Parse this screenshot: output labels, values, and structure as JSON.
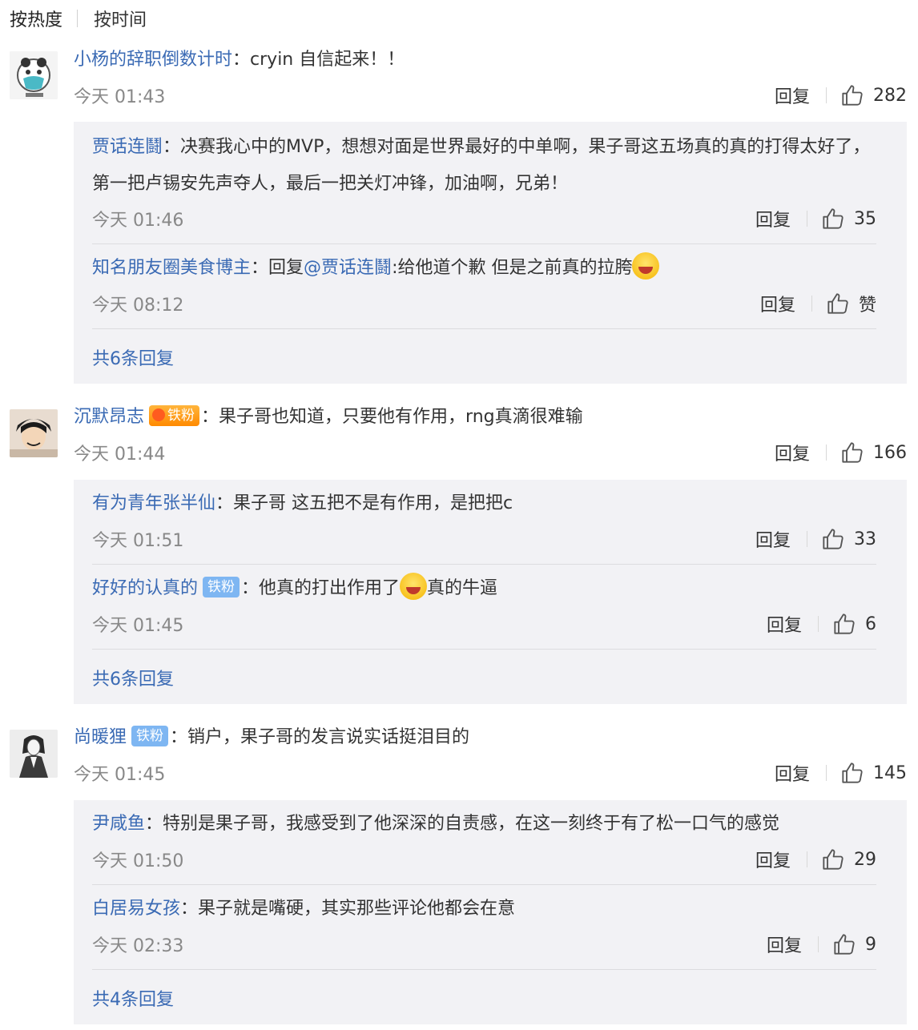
{
  "tabs": {
    "hot": "按热度",
    "time": "按时间"
  },
  "colon": "：",
  "reply_label": "回复",
  "comments": [
    {
      "user": "小杨的辞职倒数计时",
      "text": "cryin 自信起来！！",
      "time": "今天 01:43",
      "likes": "282",
      "replies": [
        {
          "user": "贾话连鬪",
          "text": "决赛我心中的MVP，想想对面是世界最好的中单啊，果子哥这五场真的真的打得太好了，第一把卢锡安先声夺人，最后一把关灯冲锋，加油啊，兄弟！",
          "time": "今天 01:46",
          "likes": "35"
        },
        {
          "user": "知名朋友圈美食博主",
          "text_prefix": "回复",
          "mention": "@贾话连鬪",
          "text": ":给他道个歉 但是之前真的拉胯",
          "emoji": "laugh-tears",
          "time": "今天 08:12",
          "likes": "赞"
        }
      ],
      "more": "共6条回复"
    },
    {
      "user": "沉默昂志",
      "badge": "铁粉",
      "badge_style": "gold",
      "text": "果子哥也知道，只要他有作用，rng真滴很难输",
      "time": "今天 01:44",
      "likes": "166",
      "replies": [
        {
          "user": "有为青年张半仙",
          "text": "果子哥 这五把不是有作用，是把把c",
          "time": "今天 01:51",
          "likes": "33"
        },
        {
          "user": "好好的认真的",
          "badge": "铁粉",
          "text_before": "他真的打出作用了",
          "emoji": "shout",
          "text": "真的牛逼",
          "time": "今天 01:45",
          "likes": "6"
        }
      ],
      "more": "共6条回复"
    },
    {
      "user": "尚暖狸",
      "badge": "铁粉",
      "badge_style": "blue",
      "text": "销户，果子哥的发言说实话挺泪目的",
      "time": "今天 01:45",
      "likes": "145",
      "replies": [
        {
          "user": "尹咸鱼",
          "text": "特别是果子哥，我感受到了他深深的自责感，在这一刻终于有了松一口气的感觉",
          "time": "今天 01:50",
          "likes": "29"
        },
        {
          "user": "白居易女孩",
          "text": "果子就是嘴硬，其实那些评论他都会在意",
          "time": "今天 02:33",
          "likes": "9"
        }
      ],
      "more": "共4条回复"
    }
  ],
  "colors": {
    "link": "#3a6ab4",
    "reply_bg": "#f2f2f5",
    "badge_blue": "#7eb6f2",
    "muted": "#888888"
  }
}
